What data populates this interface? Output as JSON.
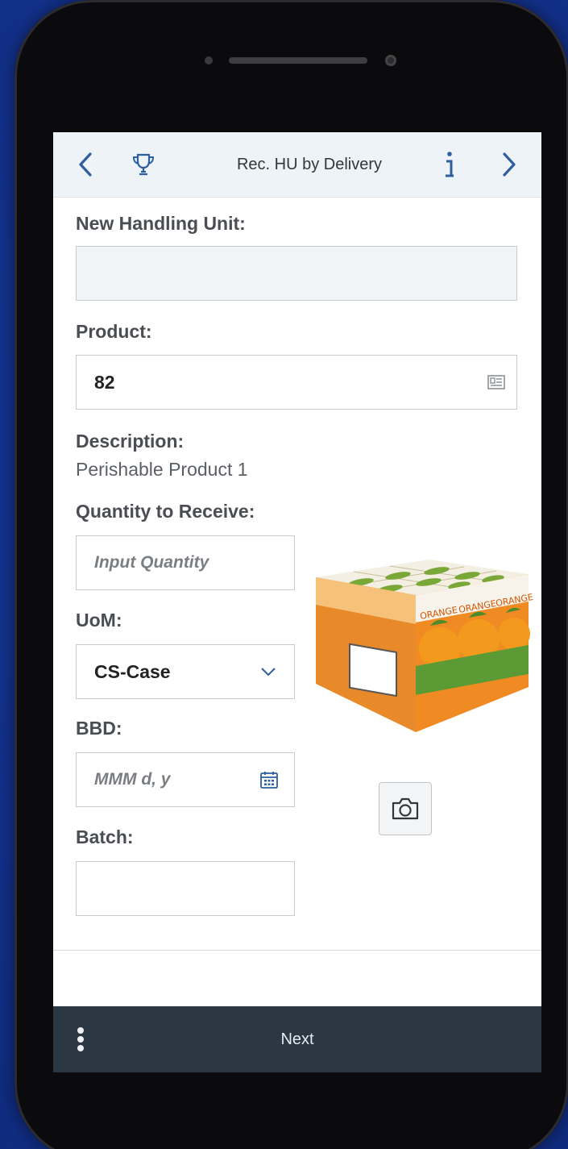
{
  "header": {
    "title": "Rec. HU by Delivery",
    "back_icon": "chevron-left-icon",
    "trophy_icon": "trophy-icon",
    "info_icon": "info-icon",
    "forward_icon": "chevron-right-icon"
  },
  "form": {
    "handling_unit": {
      "label": "New Handling Unit:",
      "value": ""
    },
    "product": {
      "label": "Product:",
      "value": "82",
      "icon": "value-help-icon"
    },
    "description": {
      "label": "Description:",
      "value": "Perishable Product 1"
    },
    "quantity": {
      "label": "Quantity to Receive:",
      "placeholder": "Input Quantity"
    },
    "uom": {
      "label": "UoM:",
      "value": "CS-Case",
      "icon": "chevron-down-icon"
    },
    "bbd": {
      "label": "BBD:",
      "placeholder": "MMM d, y",
      "icon": "calendar-icon"
    },
    "batch": {
      "label": "Batch:",
      "value": ""
    }
  },
  "product_image": {
    "brand_text": [
      "ORANGE",
      "ORANGE",
      "ORANGE"
    ]
  },
  "camera": {
    "icon": "camera-icon"
  },
  "footer": {
    "next_label": "Next",
    "more_icon": "overflow-menu-icon"
  },
  "colors": {
    "header_bg": "#eef3f8",
    "accent": "#2d5f9e",
    "footer_bg": "#2b3743",
    "background": "#17389a"
  }
}
